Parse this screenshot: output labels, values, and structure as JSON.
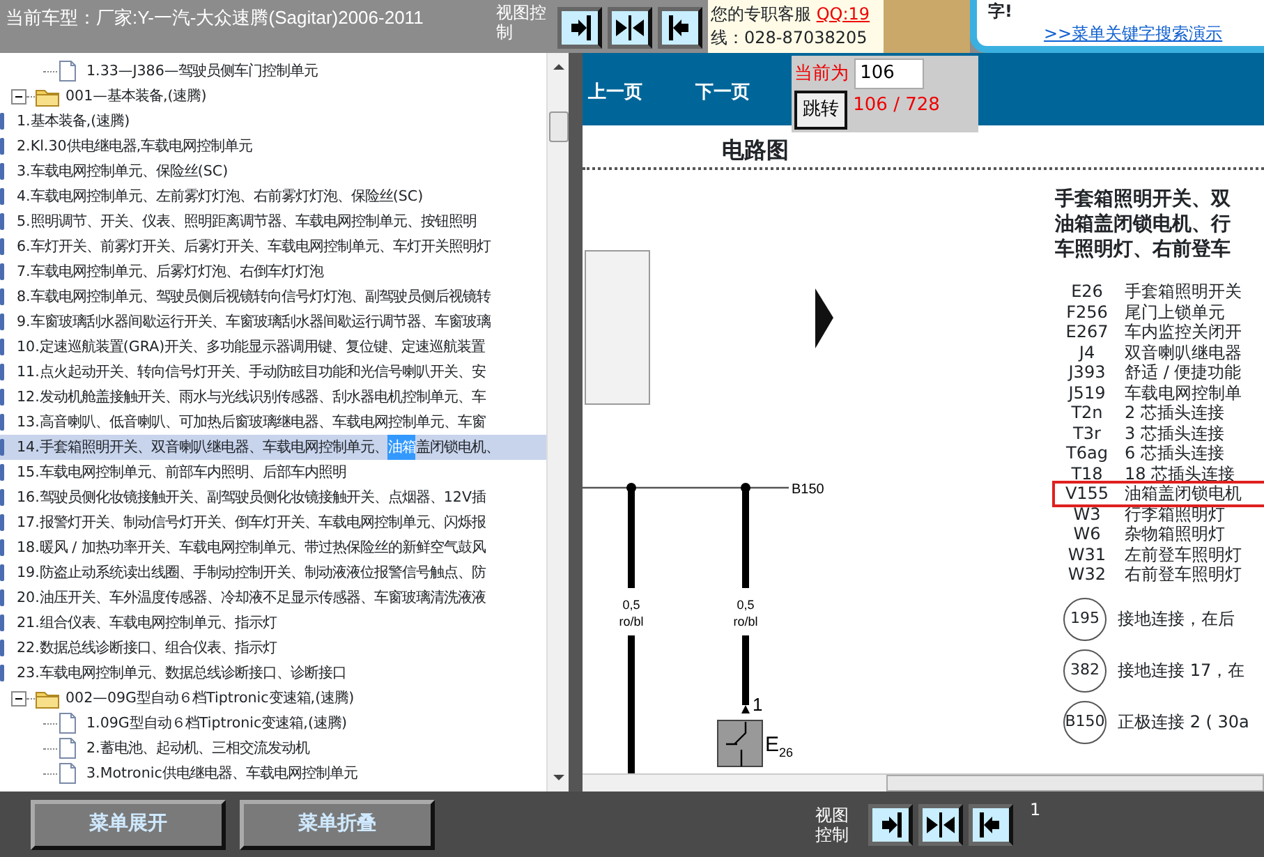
{
  "header": {
    "title": "当前车型：厂家:Y-一汽-大众速腾(Sagitar)2006-2011",
    "view_label": "视图控制",
    "service": {
      "label": "您的专职客服",
      "qq": "QQ:19",
      "phone": "线：028-87038205"
    },
    "ad": {
      "text": "字!",
      "link": ">>菜单关键字搜索演示"
    }
  },
  "tree": [
    {
      "kind": "doc",
      "label": "1.33—J386—驾驶员侧车门控制单元",
      "selected": false
    },
    {
      "kind": "folder",
      "label": "001—基本装备,(速腾)",
      "selected": false,
      "expanded": true,
      "children": [
        {
          "kind": "entry",
          "label": "1.基本装备,(速腾)",
          "selected": false
        },
        {
          "kind": "entry",
          "label": "2.Kl.30供电继电器,车载电网控制单元",
          "selected": false
        },
        {
          "kind": "entry",
          "label": "3.车载电网控制单元、保险丝(SC)",
          "selected": false
        },
        {
          "kind": "entry",
          "label": "4.车载电网控制单元、左前雾灯灯泡、右前雾灯灯泡、保险丝(SC)",
          "selected": false
        },
        {
          "kind": "entry",
          "label": "5.照明调节、开关、仪表、照明距离调节器、车载电网控制单元、按钮照明",
          "selected": false
        },
        {
          "kind": "entry",
          "label": "6.车灯开关、前雾灯开关、后雾灯开关、车载电网控制单元、车灯开关照明灯",
          "selected": false
        },
        {
          "kind": "entry",
          "label": "7.车载电网控制单元、后雾灯灯泡、右倒车灯灯泡",
          "selected": false
        },
        {
          "kind": "entry",
          "label": "8.车载电网控制单元、驾驶员侧后视镜转向信号灯灯泡、副驾驶员侧后视镜转",
          "selected": false
        },
        {
          "kind": "entry",
          "label": "9.车窗玻璃刮水器间歇运行开关、车窗玻璃刮水器间歇运行调节器、车窗玻璃",
          "selected": false
        },
        {
          "kind": "entry",
          "label": "10.定速巡航装置(GRA)开关、多功能显示器调用键、复位键、定速巡航装置",
          "selected": false
        },
        {
          "kind": "entry",
          "label": "11.点火起动开关、转向信号灯开关、手动防眩目功能和光信号喇叭开关、安",
          "selected": false
        },
        {
          "kind": "entry",
          "label": "12.发动机舱盖接触开关、雨水与光线识别传感器、刮水器电机控制单元、车",
          "selected": false
        },
        {
          "kind": "entry",
          "label": "13.高音喇叭、低音喇叭、可加热后窗玻璃继电器、车载电网控制单元、车窗",
          "selected": false
        },
        {
          "kind": "entry",
          "segments": [
            {
              "text": "14.手套箱照明开关、双音喇叭继电器、车载电网控制单元、",
              "found": false
            },
            {
              "text": "油箱",
              "found": true
            },
            {
              "text": "盖闭锁电机、",
              "found": false
            }
          ],
          "selected": true
        },
        {
          "kind": "entry",
          "label": "15.车载电网控制单元、前部车内照明、后部车内照明",
          "selected": false
        },
        {
          "kind": "entry",
          "label": "16.驾驶员侧化妆镜接触开关、副驾驶员侧化妆镜接触开关、点烟器、12V插",
          "selected": false
        },
        {
          "kind": "entry",
          "label": "17.报警灯开关、制动信号灯开关、倒车灯开关、车载电网控制单元、闪烁报",
          "selected": false
        },
        {
          "kind": "entry",
          "label": "18.暖风 / 加热功率开关、车载电网控制单元、带过热保险丝的新鲜空气鼓风",
          "selected": false
        },
        {
          "kind": "entry",
          "label": "19.防盗止动系统读出线圈、手制动控制开关、制动液液位报警信号触点、防",
          "selected": false
        },
        {
          "kind": "entry",
          "label": "20.油压开关、车外温度传感器、冷却液不足显示传感器、车窗玻璃清洗液液",
          "selected": false
        },
        {
          "kind": "entry",
          "label": "21.组合仪表、车载电网控制单元、指示灯",
          "selected": false
        },
        {
          "kind": "entry",
          "label": "22.数据总线诊断接口、组合仪表、指示灯",
          "selected": false
        },
        {
          "kind": "entry",
          "label": "23.车载电网控制单元、数据总线诊断接口、诊断接口",
          "selected": false
        }
      ]
    },
    {
      "kind": "folder",
      "label": "002—09G型自动６档Tiptronic变速箱,(速腾)",
      "selected": false,
      "expanded": true,
      "children": [
        {
          "kind": "doc",
          "label": "1.09G型自动６档Tiptronic变速箱,(速腾)",
          "selected": false
        },
        {
          "kind": "doc",
          "label": "2.蓄电池、起动机、三相交流发动机",
          "selected": false
        },
        {
          "kind": "doc",
          "label": "3.Motronic供电继电器、车载电网控制单元",
          "selected": false
        }
      ]
    }
  ],
  "pager": {
    "prev": "上一页",
    "next": "下一页",
    "current_label": "当前为",
    "page_value": "106",
    "jump": "跳转",
    "total": "106 / 728"
  },
  "document": {
    "title": "电路图",
    "heading_lines": [
      "手套箱照明开关、双",
      "油箱盖闭锁电机、行",
      "车照明灯、右前登车"
    ],
    "legend": [
      {
        "code": "E26",
        "desc": "手套箱照明开关",
        "highlighted": false
      },
      {
        "code": "F256",
        "desc": "尾门上锁单元",
        "highlighted": false
      },
      {
        "code": "E267",
        "desc": "车内监控关闭开",
        "highlighted": false
      },
      {
        "code": "J4",
        "desc": "双音喇叭继电器",
        "highlighted": false
      },
      {
        "code": "J393",
        "desc": "舒适 / 便捷功能",
        "highlighted": false
      },
      {
        "code": "J519",
        "desc": "车载电网控制单",
        "highlighted": false
      },
      {
        "code": "T2n",
        "desc": "2 芯插头连接",
        "highlighted": false
      },
      {
        "code": "T3r",
        "desc": "3 芯插头连接",
        "highlighted": false
      },
      {
        "code": "T6ag",
        "desc": "6 芯插头连接",
        "highlighted": false
      },
      {
        "code": "T18",
        "desc": "18 芯插头连接",
        "highlighted": false
      },
      {
        "code": "V155",
        "desc": "油箱盖闭锁电机",
        "highlighted": true
      },
      {
        "code": "W3",
        "desc": "行李箱照明灯",
        "highlighted": false
      },
      {
        "code": "W6",
        "desc": "杂物箱照明灯",
        "highlighted": false
      },
      {
        "code": "W31",
        "desc": "左前登车照明灯",
        "highlighted": false
      },
      {
        "code": "W32",
        "desc": "右前登车照明灯",
        "highlighted": false
      }
    ],
    "connections": [
      {
        "code": "195",
        "desc": "接地连接，在后"
      },
      {
        "code": "382",
        "desc": "接地连接 17，在"
      },
      {
        "code": "B150",
        "desc": "正极连接 2 ( 30a"
      }
    ],
    "diagram": {
      "bus_label": "B150",
      "wires": [
        {
          "gauge": "0,5",
          "color_code": "ro/bl"
        },
        {
          "gauge": "0,5",
          "color_code": "ro/bl"
        }
      ],
      "component": {
        "letter": "E",
        "index": "26",
        "pin": "1"
      }
    }
  },
  "footer": {
    "expand": "菜单展开",
    "collapse": "菜单折叠",
    "view_label": "视图控制",
    "page": "1"
  }
}
